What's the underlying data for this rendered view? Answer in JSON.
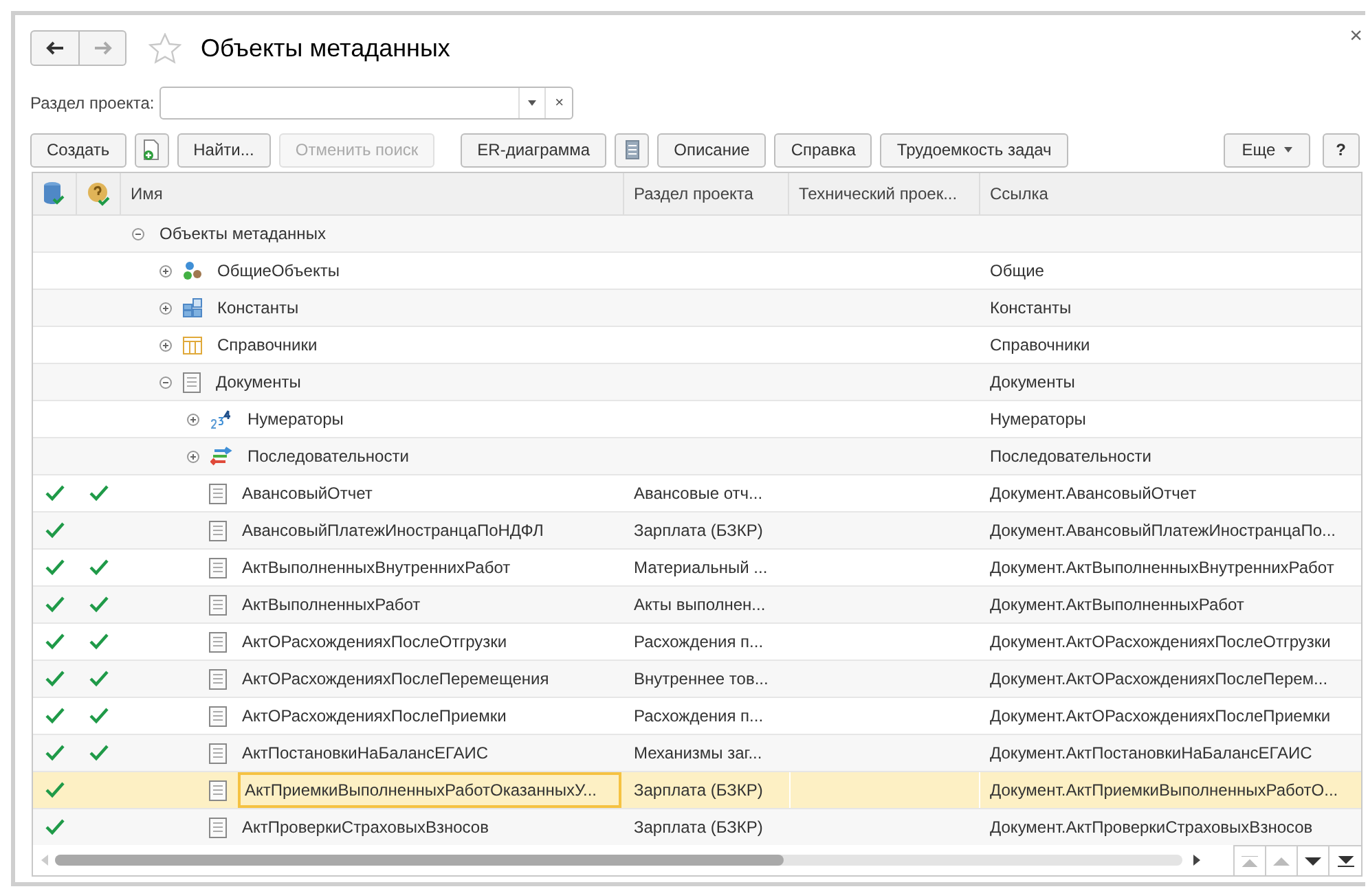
{
  "window": {
    "title": "Объекты метаданных",
    "close": "×"
  },
  "filter": {
    "label": "Раздел проекта:",
    "clear": "×"
  },
  "toolbar": [
    {
      "label": "Создать",
      "kind": "text",
      "disabled": false
    },
    {
      "kind": "add-doc",
      "disabled": false
    },
    {
      "label": "Найти...",
      "kind": "text",
      "disabled": false
    },
    {
      "label": "Отменить поиск",
      "kind": "text",
      "disabled": true
    },
    {
      "label": "ER-диаграмма",
      "kind": "text",
      "disabled": false
    },
    {
      "kind": "list",
      "disabled": false
    },
    {
      "label": "Описание",
      "kind": "text",
      "disabled": false
    },
    {
      "label": "Справка",
      "kind": "text",
      "disabled": false
    },
    {
      "label": "Трудоемкость задач",
      "kind": "text",
      "disabled": false
    }
  ],
  "toolbar_right": [
    {
      "label": "Еще",
      "kind": "menu"
    },
    {
      "label": "?",
      "kind": "text"
    }
  ],
  "table": {
    "columns": [
      {
        "kind": "stored-icon"
      },
      {
        "kind": "checked-icon"
      },
      {
        "kind": "text",
        "label": "Имя"
      },
      {
        "kind": "text",
        "label": "Раздел проекта"
      },
      {
        "kind": "text",
        "label": "Технический проек..."
      },
      {
        "kind": "text",
        "label": "Ссылка"
      }
    ],
    "rows": [
      {
        "name": "Объекты метаданных",
        "expanded": true,
        "stored": false,
        "checked": false,
        "selected": false,
        "children": [
          {
            "name": "ОбщиеОбъекты",
            "kind": "common",
            "expanded": false,
            "link": "Общие",
            "stored": false,
            "checked": false,
            "selected": false
          },
          {
            "name": "Константы",
            "kind": "constants",
            "expanded": false,
            "link": "Константы",
            "stored": false,
            "checked": false,
            "selected": false
          },
          {
            "name": "Справочники",
            "kind": "catalogs",
            "expanded": false,
            "link": "Справочники",
            "stored": false,
            "checked": false,
            "selected": false
          },
          {
            "name": "Документы",
            "kind": "documents",
            "expanded": true,
            "link": "Документы",
            "stored": false,
            "checked": false,
            "selected": false,
            "children": [
              {
                "name": "Нумераторы",
                "kind": "numerators",
                "expanded": false,
                "link": "Нумераторы",
                "stored": false,
                "checked": false,
                "selected": false
              },
              {
                "name": "Последовательности",
                "kind": "sequences",
                "expanded": false,
                "link": "Последовательности",
                "stored": false,
                "checked": false,
                "selected": false
              },
              {
                "name": "АвансовыйОтчет",
                "kind": "document",
                "section": "Авансовые отч...",
                "link": "Документ.АвансовыйОтчет",
                "stored": true,
                "checked": true,
                "selected": false
              },
              {
                "name": "АвансовыйПлатежИностранцаПоНДФЛ",
                "kind": "document",
                "section": "Зарплата (БЗКР)",
                "link": "Документ.АвансовыйПлатежИностранцаПо...",
                "stored": true,
                "checked": false,
                "selected": false
              },
              {
                "name": "АктВыполненныхВнутреннихРабот",
                "kind": "document",
                "section": "Материальный ...",
                "link": "Документ.АктВыполненныхВнутреннихРабот",
                "stored": true,
                "checked": true,
                "selected": false
              },
              {
                "name": "АктВыполненныхРабот",
                "kind": "document",
                "section": "Акты выполнен...",
                "link": "Документ.АктВыполненныхРабот",
                "stored": true,
                "checked": true,
                "selected": false
              },
              {
                "name": "АктОРасхожденияхПослеОтгрузки",
                "kind": "document",
                "section": "Расхождения п...",
                "link": "Документ.АктОРасхожденияхПослеОтгрузки",
                "stored": true,
                "checked": true,
                "selected": false
              },
              {
                "name": "АктОРасхожденияхПослеПеремещения",
                "kind": "document",
                "section": "Внутреннее тов...",
                "link": "Документ.АктОРасхожденияхПослеПерем...",
                "stored": true,
                "checked": true,
                "selected": false
              },
              {
                "name": "АктОРасхожденияхПослеПриемки",
                "kind": "document",
                "section": "Расхождения п...",
                "link": "Документ.АктОРасхожденияхПослеПриемки",
                "stored": true,
                "checked": true,
                "selected": false
              },
              {
                "name": "АктПостановкиНаБалансЕГАИС",
                "kind": "document",
                "section": "Механизмы заг...",
                "link": "Документ.АктПостановкиНаБалансЕГАИС",
                "stored": true,
                "checked": true,
                "selected": false
              },
              {
                "name": "АктПриемкиВыполненныхРаботОказанныхУ...",
                "kind": "document",
                "section": "Зарплата (БЗКР)",
                "link": "Документ.АктПриемкиВыполненныхРаботО...",
                "stored": true,
                "checked": false,
                "selected": true
              },
              {
                "name": "АктПроверкиСтраховыхВзносов",
                "kind": "document",
                "section": "Зарплата (БЗКР)",
                "link": "Документ.АктПроверкиСтраховыхВзносов",
                "stored": true,
                "checked": false,
                "selected": false
              }
            ]
          }
        ]
      }
    ]
  }
}
